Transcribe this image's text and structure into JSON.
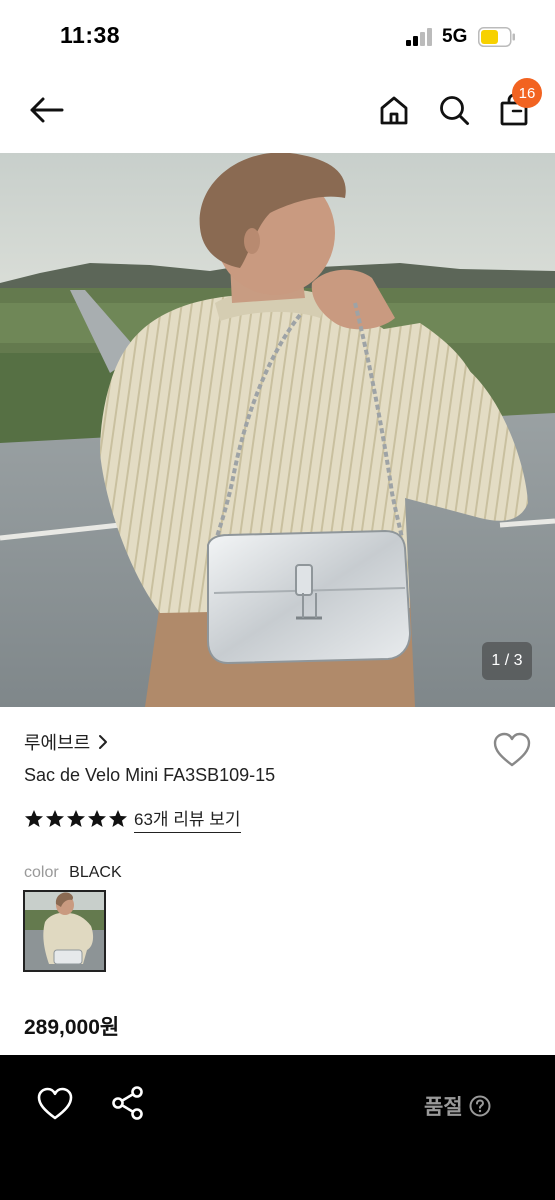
{
  "status_bar": {
    "time": "11:38",
    "network": "5G"
  },
  "header": {
    "cart_count": "16"
  },
  "gallery": {
    "counter": "1 / 3"
  },
  "product": {
    "brand": "루에브르",
    "name": "Sac de Velo Mini FA3SB109-15",
    "rating_stars": 5,
    "review_link": "63개 리뷰 보기",
    "color_label": "color",
    "color_value": "BLACK",
    "price": "289,000원"
  },
  "bottom_bar": {
    "status": "품절"
  },
  "colors": {
    "badge": "#f26321",
    "bottom_bar_bg": "#000000",
    "disabled_text": "#9a9a9a"
  },
  "icons": [
    "back-arrow-icon",
    "home-icon",
    "search-icon",
    "shopping-bag-icon",
    "heart-icon",
    "share-icon",
    "question-circle-icon",
    "star-icon"
  ]
}
